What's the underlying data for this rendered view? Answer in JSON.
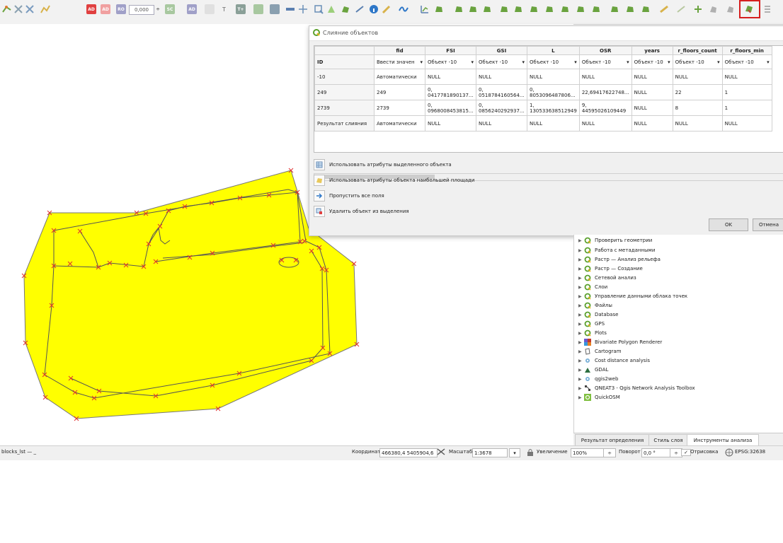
{
  "toolbar": {
    "angle_value": "0,000",
    "label_ad": "AD",
    "label_ad2": "AD",
    "label_t": "T",
    "label_tplus": "T+"
  },
  "dialog": {
    "title": "Слияние объектов",
    "columns": [
      "fid",
      "FSI",
      "GSI",
      "L",
      "OSR",
      "years",
      "r_floors_count",
      "r_floors_min"
    ],
    "id_row": {
      "label": "ID",
      "cells": [
        "Ввести значен",
        "Объект -10",
        "Объект -10",
        "Объект -10",
        "Объект -10",
        "Объект -10",
        "Объект -10",
        "Объект -10"
      ]
    },
    "rows": [
      {
        "id": "-10",
        "cells": [
          "Автоматически",
          "NULL",
          "NULL",
          "NULL",
          "NULL",
          "NULL",
          "NULL",
          "NULL"
        ]
      },
      {
        "id": "249",
        "cells": [
          "249",
          "0,\n0417781890137...",
          "0,\n0518784160564...",
          "0,\n8053096487806...",
          "22,69417622748...",
          "NULL",
          "22",
          "1"
        ]
      },
      {
        "id": "2739",
        "cells": [
          "2739",
          "0,\n0968008453815...",
          "0,\n0856240292937...",
          "1,\n130533638512949",
          "9,\n44595026109449",
          "NULL",
          "8",
          "1"
        ]
      },
      {
        "id": "Результат слияния",
        "cells": [
          "Автоматически",
          "NULL",
          "NULL",
          "NULL",
          "NULL",
          "NULL",
          "NULL",
          "NULL"
        ]
      }
    ],
    "actions": [
      "Использовать атрибуты выделенного объекта",
      "Использовать атрибуты объекта наибольшей площади",
      "Пропустить все поля",
      "Удалить объект из выделения"
    ],
    "ok_label": "OK",
    "cancel_label": "Отмена"
  },
  "tree": {
    "items": [
      "Проверить геометрии",
      "Работа с метаданными",
      "Растр — Анализ рельефа",
      "Растр — Создание",
      "Сетевой анализ",
      "Слои",
      "Управление данными облака точек",
      "Файлы",
      "Database",
      "GPS",
      "Plots",
      "Bivariate Polygon Renderer",
      "Cartogram",
      "Cost distance analysis",
      "GDAL",
      "qgis2web",
      "QNEAT3 - Qgis Network Analysis Toolbox",
      "QuickOSM"
    ]
  },
  "tabs": [
    "Результат определения",
    "Стиль слоя",
    "Инструменты анализа"
  ],
  "status": {
    "locator": "blocks_lst — _",
    "coords_label": "Координаты",
    "coords_value": "466380,4  5405904,6",
    "scale_label": "Масштаб",
    "scale_value": "1:3678",
    "magnifier_label": "Увеличение",
    "magnifier_value": "100%",
    "rotation_label": "Поворот",
    "rotation_value": "0,0 °",
    "render_label": "Отрисовка",
    "crs": "EPSG:32638"
  },
  "colors": {
    "polygon_fill": "#ffff00",
    "vertex_marker": "#e03030",
    "highlight": "#d61f1f",
    "qgis_green": "#5aa02c"
  }
}
